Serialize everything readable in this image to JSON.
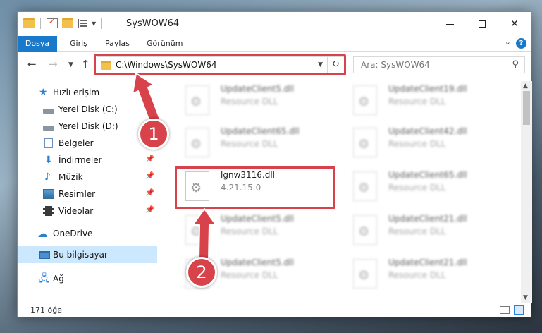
{
  "window": {
    "title": "SysWOW64"
  },
  "ribbon": {
    "tabs": [
      "Dosya",
      "Giriş",
      "Paylaş",
      "Görünüm"
    ],
    "help": "?"
  },
  "nav": {
    "address": "C:\\Windows\\SysWOW64",
    "search_placeholder": "Ara: SysWOW64"
  },
  "sidebar": {
    "items": [
      {
        "label": "Hızlı erişim",
        "icon": "star-icon"
      },
      {
        "label": "Yerel Disk (C:)",
        "icon": "drive-icon",
        "pinned": true
      },
      {
        "label": "Yerel Disk (D:)",
        "icon": "drive-icon",
        "pinned": true
      },
      {
        "label": "Belgeler",
        "icon": "documents-icon",
        "pinned": true
      },
      {
        "label": "İndirmeler",
        "icon": "download-icon",
        "pinned": true
      },
      {
        "label": "Müzik",
        "icon": "music-icon",
        "pinned": true
      },
      {
        "label": "Resimler",
        "icon": "pictures-icon",
        "pinned": true
      },
      {
        "label": "Videolar",
        "icon": "videos-icon",
        "pinned": true
      },
      {
        "label": "OneDrive",
        "icon": "cloud-icon"
      },
      {
        "label": "Bu bilgisayar",
        "icon": "computer-icon",
        "selected": true
      },
      {
        "label": "Ağ",
        "icon": "network-icon"
      }
    ]
  },
  "files": [
    {
      "name": "UpdateClient5.dll",
      "desc": "Resource DLL",
      "blurred": true
    },
    {
      "name": "UpdateClient19.dll",
      "desc": "Resource DLL",
      "blurred": true
    },
    {
      "name": "UpdateClient65.dll",
      "desc": "Resource DLL",
      "blurred": true
    },
    {
      "name": "UpdateClient42.dll",
      "desc": "Resource DLL",
      "blurred": true
    },
    {
      "name": "lgnw3116.dll",
      "desc": "4.21.15.0",
      "blurred": false
    },
    {
      "name": "UpdateClient65.dll",
      "desc": "Resource DLL",
      "blurred": true
    },
    {
      "name": "UpdateClient5.dll",
      "desc": "Resource DLL",
      "blurred": true
    },
    {
      "name": "UpdateClient21.dll",
      "desc": "Resource DLL",
      "blurred": true
    },
    {
      "name": "UpdateClient5.dll",
      "desc": "Resource DLL",
      "blurred": true
    },
    {
      "name": "UpdateClient21.dll",
      "desc": "Resource DLL",
      "blurred": true
    }
  ],
  "status": {
    "count": "171 öğe"
  },
  "annotations": {
    "badge1": "1",
    "badge2": "2",
    "color": "#d8424a"
  }
}
